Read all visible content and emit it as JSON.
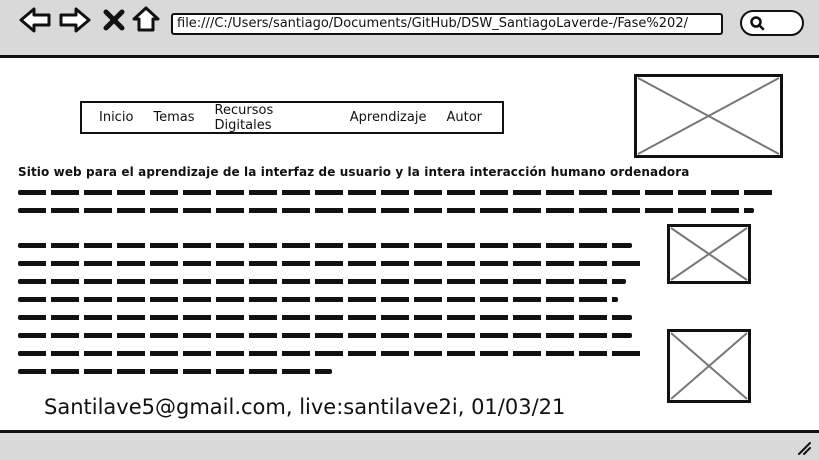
{
  "browser": {
    "url": "file:///C:/Users/santiago/Documents/GitHub/DSW_SantiagoLaverde-/Fase%202/",
    "icons": [
      "back-icon",
      "forward-icon",
      "close-icon",
      "home-icon",
      "search-icon"
    ]
  },
  "nav": {
    "items": [
      "Inicio",
      "Temas",
      "Recursos Digitales",
      "Aprendizaje",
      "Autor"
    ]
  },
  "main": {
    "headline": "Sitio web para el aprendizaje de la interfaz de usuario y la intera interacción humano ordenadora"
  },
  "footer": {
    "contact": "Santilave5@gmail.com, live:santilave2i,  01/03/21"
  },
  "colors": {
    "chrome": "#d9d9d9",
    "stroke": "#111111",
    "background": "#ffffff"
  }
}
